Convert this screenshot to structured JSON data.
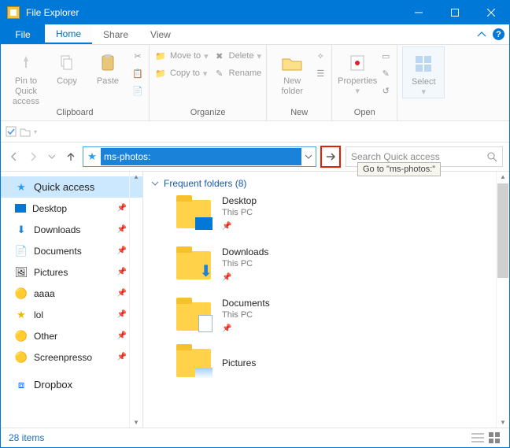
{
  "window": {
    "title": "File Explorer"
  },
  "tabs": {
    "file": "File",
    "home": "Home",
    "share": "Share",
    "view": "View"
  },
  "ribbon": {
    "clipboard": {
      "label": "Clipboard",
      "pin": "Pin to Quick\naccess",
      "copy": "Copy",
      "paste": "Paste"
    },
    "organize": {
      "label": "Organize",
      "move": "Move to",
      "copy": "Copy to",
      "delete": "Delete",
      "rename": "Rename"
    },
    "new": {
      "label": "New",
      "folder": "New\nfolder"
    },
    "open": {
      "label": "Open",
      "properties": "Properties"
    },
    "select": {
      "select": "Select"
    }
  },
  "address": {
    "value": "ms-photos:"
  },
  "search": {
    "placeholder": "Search Quick access"
  },
  "tooltip": {
    "go": "Go to \"ms-photos:\""
  },
  "sidebar": {
    "quick_access": "Quick access",
    "items": [
      {
        "name": "Desktop"
      },
      {
        "name": "Downloads"
      },
      {
        "name": "Documents"
      },
      {
        "name": "Pictures"
      },
      {
        "name": "aaaa"
      },
      {
        "name": "lol"
      },
      {
        "name": "Other"
      },
      {
        "name": "Screenpresso"
      }
    ],
    "dropbox": "Dropbox"
  },
  "content": {
    "section_title": "Frequent folders (8)",
    "tiles": [
      {
        "name": "Desktop",
        "location": "This PC"
      },
      {
        "name": "Downloads",
        "location": "This PC"
      },
      {
        "name": "Documents",
        "location": "This PC"
      },
      {
        "name": "Pictures",
        "location": ""
      }
    ]
  },
  "status": {
    "item_count": "28 items"
  }
}
